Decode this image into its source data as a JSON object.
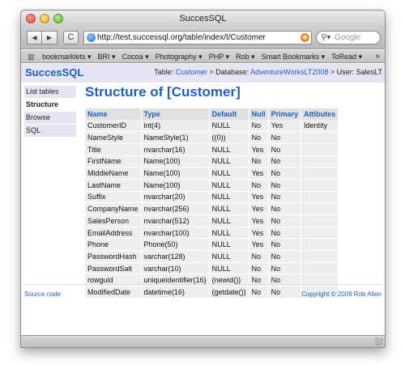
{
  "window": {
    "title": "SuccesSQL"
  },
  "toolbar": {
    "back_icon": "◀",
    "forward_icon": "▶",
    "reload_icon": "C",
    "url": "http://test.successql.org/table/index/t/Customer",
    "search_placeholder": "Google"
  },
  "bookmarks": [
    {
      "label": "bookmarklets ▾"
    },
    {
      "label": "BRI ▾"
    },
    {
      "label": "Cocoa ▾"
    },
    {
      "label": "Photography ▾"
    },
    {
      "label": "PHP ▾"
    },
    {
      "label": "Rob ▾"
    },
    {
      "label": "Smart Bookmarks ▾"
    },
    {
      "label": "ToRead ▾"
    }
  ],
  "header": {
    "logo": "SuccesSQL",
    "table_label": "Table:",
    "table_value": "Customer",
    "database_label": "> Database:",
    "database_value": "AdventureWorksLT2008",
    "user_label": "> User: SalesLT"
  },
  "sidebar": {
    "items": [
      {
        "label": "List tables"
      },
      {
        "label": "Structure"
      },
      {
        "label": "Browse"
      },
      {
        "label": "SQL"
      }
    ]
  },
  "main": {
    "title": "Structure of [Customer]",
    "columns": [
      "Name",
      "Type",
      "Default",
      "Null",
      "Primary",
      "Attibutes"
    ],
    "rows": [
      [
        "CustomerID",
        "int(4)",
        "NULL",
        "No",
        "Yes",
        "Identity"
      ],
      [
        "NameStyle",
        "NameStyle(1)",
        "((0))",
        "No",
        "No",
        ""
      ],
      [
        "Title",
        "nvarchar(16)",
        "NULL",
        "Yes",
        "No",
        ""
      ],
      [
        "FirstName",
        "Name(100)",
        "NULL",
        "No",
        "No",
        ""
      ],
      [
        "MiddleName",
        "Name(100)",
        "NULL",
        "Yes",
        "No",
        ""
      ],
      [
        "LastName",
        "Name(100)",
        "NULL",
        "No",
        "No",
        ""
      ],
      [
        "Suffix",
        "nvarchar(20)",
        "NULL",
        "Yes",
        "No",
        ""
      ],
      [
        "CompanyName",
        "nvarchar(256)",
        "NULL",
        "Yes",
        "No",
        ""
      ],
      [
        "SalesPerson",
        "nvarchar(512)",
        "NULL",
        "Yes",
        "No",
        ""
      ],
      [
        "EmailAddress",
        "nvarchar(100)",
        "NULL",
        "Yes",
        "No",
        ""
      ],
      [
        "Phone",
        "Phone(50)",
        "NULL",
        "Yes",
        "No",
        ""
      ],
      [
        "PasswordHash",
        "varchar(128)",
        "NULL",
        "No",
        "No",
        ""
      ],
      [
        "PasswordSalt",
        "varchar(10)",
        "NULL",
        "No",
        "No",
        ""
      ],
      [
        "rowguid",
        "uniqueidentifier(16)",
        "(newid())",
        "No",
        "No",
        ""
      ],
      [
        "ModifiedDate",
        "datetime(16)",
        "(getdate())",
        "No",
        "No",
        ""
      ]
    ]
  },
  "footer": {
    "source_link": "Source code",
    "copyright": "Copyright © 2009 Rob Allen"
  },
  "colors": {
    "accent": "#1f5fbf",
    "header_bg": "#e4e4f2"
  }
}
